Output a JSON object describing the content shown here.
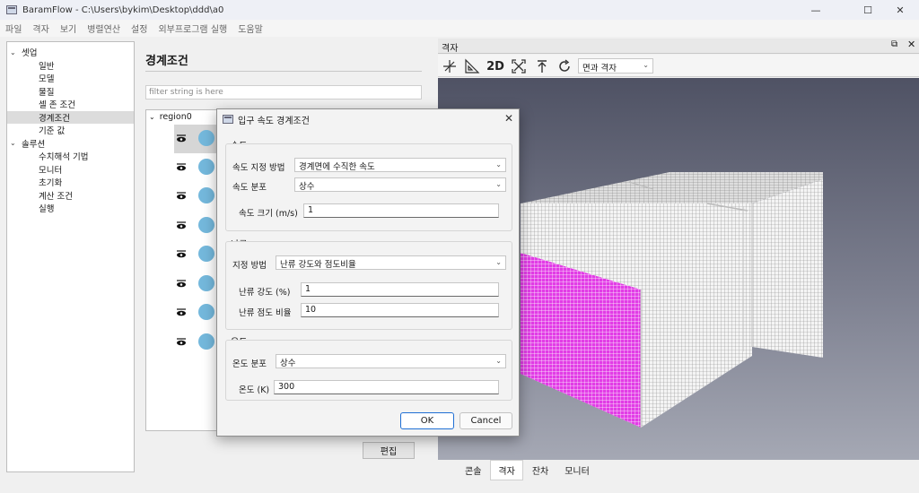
{
  "window": {
    "title": "BaramFlow - C:\\Users\\bykim\\Desktop\\ddd\\a0",
    "minimize": "—",
    "maximize": "☐",
    "close": "✕"
  },
  "menu": [
    "파일",
    "격자",
    "보기",
    "병렬연산",
    "설정",
    "외부프로그램 실행",
    "도움말"
  ],
  "tree": [
    {
      "label": "셋업",
      "level": 0,
      "caret": "⌄"
    },
    {
      "label": "일반",
      "level": 1
    },
    {
      "label": "모델",
      "level": 1
    },
    {
      "label": "물질",
      "level": 1
    },
    {
      "label": "셀 존 조건",
      "level": 1
    },
    {
      "label": "경계조건",
      "level": 1,
      "selected": true
    },
    {
      "label": "기준 값",
      "level": 1
    },
    {
      "label": "솔루션",
      "level": 0,
      "caret": "⌄"
    },
    {
      "label": "수치해석 기법",
      "level": 1
    },
    {
      "label": "모니터",
      "level": 1
    },
    {
      "label": "초기화",
      "level": 1
    },
    {
      "label": "계산 조건",
      "level": 1
    },
    {
      "label": "실행",
      "level": 1
    }
  ],
  "boundary": {
    "title": "경계조건",
    "filter_placeholder": "filter string is here",
    "region": "region0",
    "edit_button": "편집"
  },
  "viewport": {
    "title": "격자",
    "mode_2d": "2D",
    "display_mode": "면과 격자",
    "tabs": [
      "콘솔",
      "격자",
      "잔차",
      "모니터"
    ],
    "active_tab": 1
  },
  "dialog": {
    "title": "입구 속도 경계조건",
    "velocity": {
      "group": "속도",
      "spec_label": "속도 지정 방법",
      "spec_value": "경계면에 수직한 속도",
      "profile_label": "속도 분포",
      "profile_value": "상수",
      "magnitude_label": "속도 크기 (m/s)",
      "magnitude_value": "1"
    },
    "turbulence": {
      "group": "난류",
      "spec_label": "지정 방법",
      "spec_value": "난류 강도와 점도비율",
      "intensity_label": "난류 강도 (%)",
      "intensity_value": "1",
      "viscosity_label": "난류 점도 비율",
      "viscosity_value": "10"
    },
    "temperature": {
      "group": "온도",
      "profile_label": "온도 분포",
      "profile_value": "상수",
      "value_label": "온도 (K)",
      "value": "300"
    },
    "ok": "OK",
    "cancel": "Cancel"
  },
  "colors": {
    "mesh_magenta": "#e23ce6",
    "surface_blue": "#74b8dc",
    "accent": "#1f6fd4"
  }
}
